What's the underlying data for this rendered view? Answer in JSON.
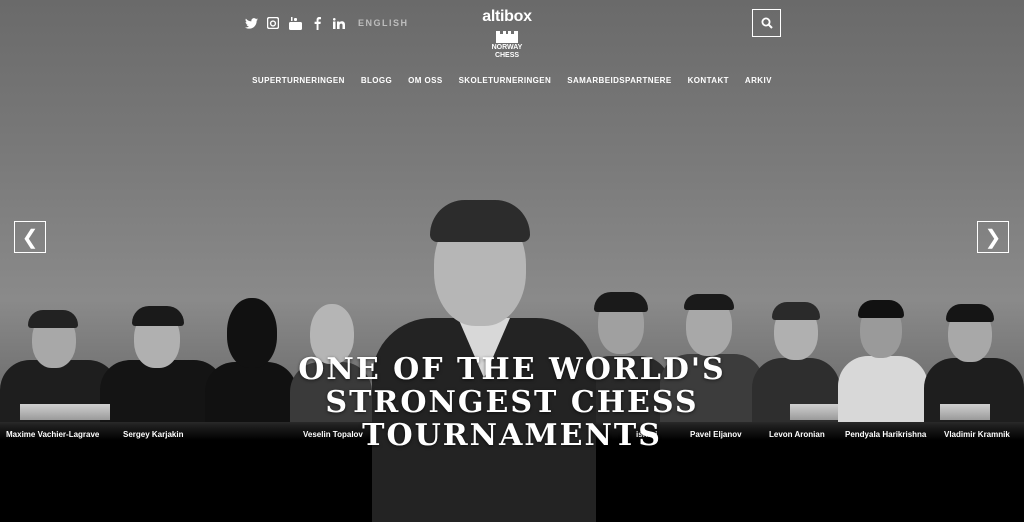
{
  "header": {
    "social_icons": [
      "twitter-icon",
      "instagram-icon",
      "youtube-icon",
      "facebook-icon",
      "linkedin-icon"
    ],
    "language_label": "ENGLISH",
    "logo": {
      "brand": "altibox",
      "line1": "NORWAY",
      "line2": "CHESS"
    },
    "search_icon": "search-icon"
  },
  "nav": {
    "items": [
      "SUPERTURNERINGEN",
      "BLOGG",
      "OM OSS",
      "SKOLETURNERINGEN",
      "SAMARBEIDSPARTNERE",
      "KONTAKT",
      "ARKIV"
    ]
  },
  "slider": {
    "prev": "❮",
    "next": "❯",
    "headline_line1": "ONE OF THE WORLD'S",
    "headline_line2": "STRONGEST CHESS",
    "headline_line3": "TOURNAMENTS"
  },
  "players": [
    "Maxime Vachier-Lagrave",
    "Sergey Karjakin",
    "Veselin Topalov",
    "Pavel Eljanov",
    "Levon Aronian",
    "Pendyala Harikrishna",
    "Vladimir Kramnik"
  ],
  "partial_name": "ishi  ri",
  "colors": {
    "background": "#000000",
    "text": "#ffffff"
  }
}
